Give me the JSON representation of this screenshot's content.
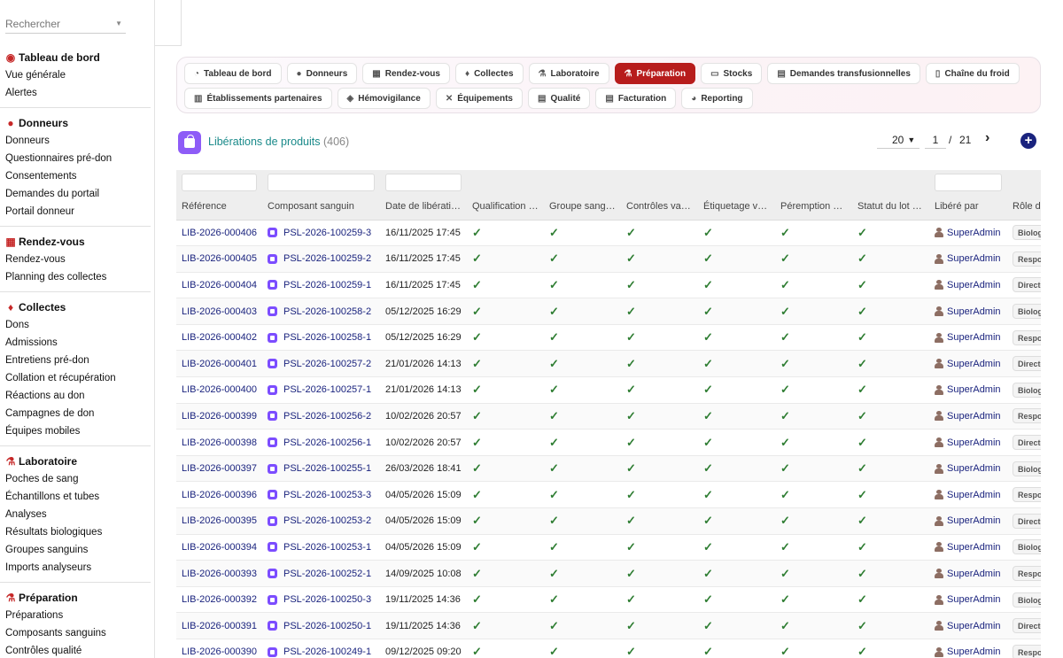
{
  "search": {
    "placeholder": "Rechercher"
  },
  "sidebar": {
    "sections": [
      {
        "title": "Tableau de bord",
        "icon": "dashboard-icon",
        "items": [
          "Vue générale",
          "Alertes"
        ]
      },
      {
        "title": "Donneurs",
        "icon": "user-icon",
        "items": [
          "Donneurs",
          "Questionnaires pré-don",
          "Consentements",
          "Demandes du portail",
          "Portail donneur"
        ]
      },
      {
        "title": "Rendez-vous",
        "icon": "calendar-icon",
        "items": [
          "Rendez-vous",
          "Planning des collectes"
        ]
      },
      {
        "title": "Collectes",
        "icon": "drop-icon",
        "items": [
          "Dons",
          "Admissions",
          "Entretiens pré-don",
          "Collation et récupération",
          "Réactions au don",
          "Campagnes de don",
          "Équipes mobiles"
        ]
      },
      {
        "title": "Laboratoire",
        "icon": "microscope-icon",
        "items": [
          "Poches de sang",
          "Échantillons et tubes",
          "Analyses",
          "Résultats biologiques",
          "Groupes sanguins",
          "Imports analyseurs"
        ]
      },
      {
        "title": "Préparation",
        "icon": "flask-icon",
        "items": [
          "Préparations",
          "Composants sanguins",
          "Contrôles qualité"
        ]
      }
    ]
  },
  "nav": {
    "row1": [
      {
        "label": "Tableau de bord",
        "icon": "◔",
        "active": false
      },
      {
        "label": "Donneurs",
        "icon": "●",
        "active": false
      },
      {
        "label": "Rendez-vous",
        "icon": "▦",
        "active": false
      },
      {
        "label": "Collectes",
        "icon": "♦",
        "active": false
      },
      {
        "label": "Laboratoire",
        "icon": "⚗",
        "active": false
      },
      {
        "label": "Préparation",
        "icon": "⚗",
        "active": true
      },
      {
        "label": "Stocks",
        "icon": "▭",
        "active": false
      },
      {
        "label": "Demandes transfusionnelles",
        "icon": "▤",
        "active": false
      },
      {
        "label": "Chaîne du froid",
        "icon": "▯",
        "active": false
      }
    ],
    "row2": [
      {
        "label": "Établissements partenaires",
        "icon": "▥",
        "active": false
      },
      {
        "label": "Hémovigilance",
        "icon": "◈",
        "active": false
      },
      {
        "label": "Équipements",
        "icon": "✕",
        "active": false
      },
      {
        "label": "Qualité",
        "icon": "▤",
        "active": false
      },
      {
        "label": "Facturation",
        "icon": "▤",
        "active": false
      },
      {
        "label": "Reporting",
        "icon": "◕",
        "active": false
      }
    ]
  },
  "page": {
    "title": "Libérations de produits",
    "count": "(406)"
  },
  "pagination": {
    "page_size": "20",
    "current_page": "1",
    "separator": "/",
    "total_pages": "21"
  },
  "table": {
    "headers": [
      "Référence",
      "Composant sanguin",
      "Date de libérati…",
      "Qualification …",
      "Groupe sang…",
      "Contrôles va…",
      "Étiquetage v…",
      "Péremption …",
      "Statut du lot …",
      "Libéré par",
      "Rôle d"
    ],
    "rows": [
      {
        "ref": "LIB-2026-000406",
        "component": "PSL-2026-100259-3",
        "date": "16/11/2025 17:45",
        "released_by": "SuperAdmin",
        "role": "Biolog"
      },
      {
        "ref": "LIB-2026-000405",
        "component": "PSL-2026-100259-2",
        "date": "16/11/2025 17:45",
        "released_by": "SuperAdmin",
        "role": "Respo"
      },
      {
        "ref": "LIB-2026-000404",
        "component": "PSL-2026-100259-1",
        "date": "16/11/2025 17:45",
        "released_by": "SuperAdmin",
        "role": "Directe"
      },
      {
        "ref": "LIB-2026-000403",
        "component": "PSL-2026-100258-2",
        "date": "05/12/2025 16:29",
        "released_by": "SuperAdmin",
        "role": "Biolog"
      },
      {
        "ref": "LIB-2026-000402",
        "component": "PSL-2026-100258-1",
        "date": "05/12/2025 16:29",
        "released_by": "SuperAdmin",
        "role": "Respo"
      },
      {
        "ref": "LIB-2026-000401",
        "component": "PSL-2026-100257-2",
        "date": "21/01/2026 14:13",
        "released_by": "SuperAdmin",
        "role": "Directe"
      },
      {
        "ref": "LIB-2026-000400",
        "component": "PSL-2026-100257-1",
        "date": "21/01/2026 14:13",
        "released_by": "SuperAdmin",
        "role": "Biolog"
      },
      {
        "ref": "LIB-2026-000399",
        "component": "PSL-2026-100256-2",
        "date": "10/02/2026 20:57",
        "released_by": "SuperAdmin",
        "role": "Respo"
      },
      {
        "ref": "LIB-2026-000398",
        "component": "PSL-2026-100256-1",
        "date": "10/02/2026 20:57",
        "released_by": "SuperAdmin",
        "role": "Directe"
      },
      {
        "ref": "LIB-2026-000397",
        "component": "PSL-2026-100255-1",
        "date": "26/03/2026 18:41",
        "released_by": "SuperAdmin",
        "role": "Biolog"
      },
      {
        "ref": "LIB-2026-000396",
        "component": "PSL-2026-100253-3",
        "date": "04/05/2026 15:09",
        "released_by": "SuperAdmin",
        "role": "Respo"
      },
      {
        "ref": "LIB-2026-000395",
        "component": "PSL-2026-100253-2",
        "date": "04/05/2026 15:09",
        "released_by": "SuperAdmin",
        "role": "Directe"
      },
      {
        "ref": "LIB-2026-000394",
        "component": "PSL-2026-100253-1",
        "date": "04/05/2026 15:09",
        "released_by": "SuperAdmin",
        "role": "Biolog"
      },
      {
        "ref": "LIB-2026-000393",
        "component": "PSL-2026-100252-1",
        "date": "14/09/2025 10:08",
        "released_by": "SuperAdmin",
        "role": "Respo"
      },
      {
        "ref": "LIB-2026-000392",
        "component": "PSL-2026-100250-3",
        "date": "19/11/2025 14:36",
        "released_by": "SuperAdmin",
        "role": "Biolog"
      },
      {
        "ref": "LIB-2026-000391",
        "component": "PSL-2026-100250-1",
        "date": "19/11/2025 14:36",
        "released_by": "SuperAdmin",
        "role": "Directe"
      },
      {
        "ref": "LIB-2026-000390",
        "component": "PSL-2026-100249-1",
        "date": "09/12/2025 09:20",
        "released_by": "SuperAdmin",
        "role": "Respo"
      }
    ]
  },
  "colors": {
    "accent": "#b71c1c",
    "link": "#1a237e",
    "check": "#2e7d32",
    "title": "#1a8a8a",
    "component_icon": "#7c4dff"
  }
}
